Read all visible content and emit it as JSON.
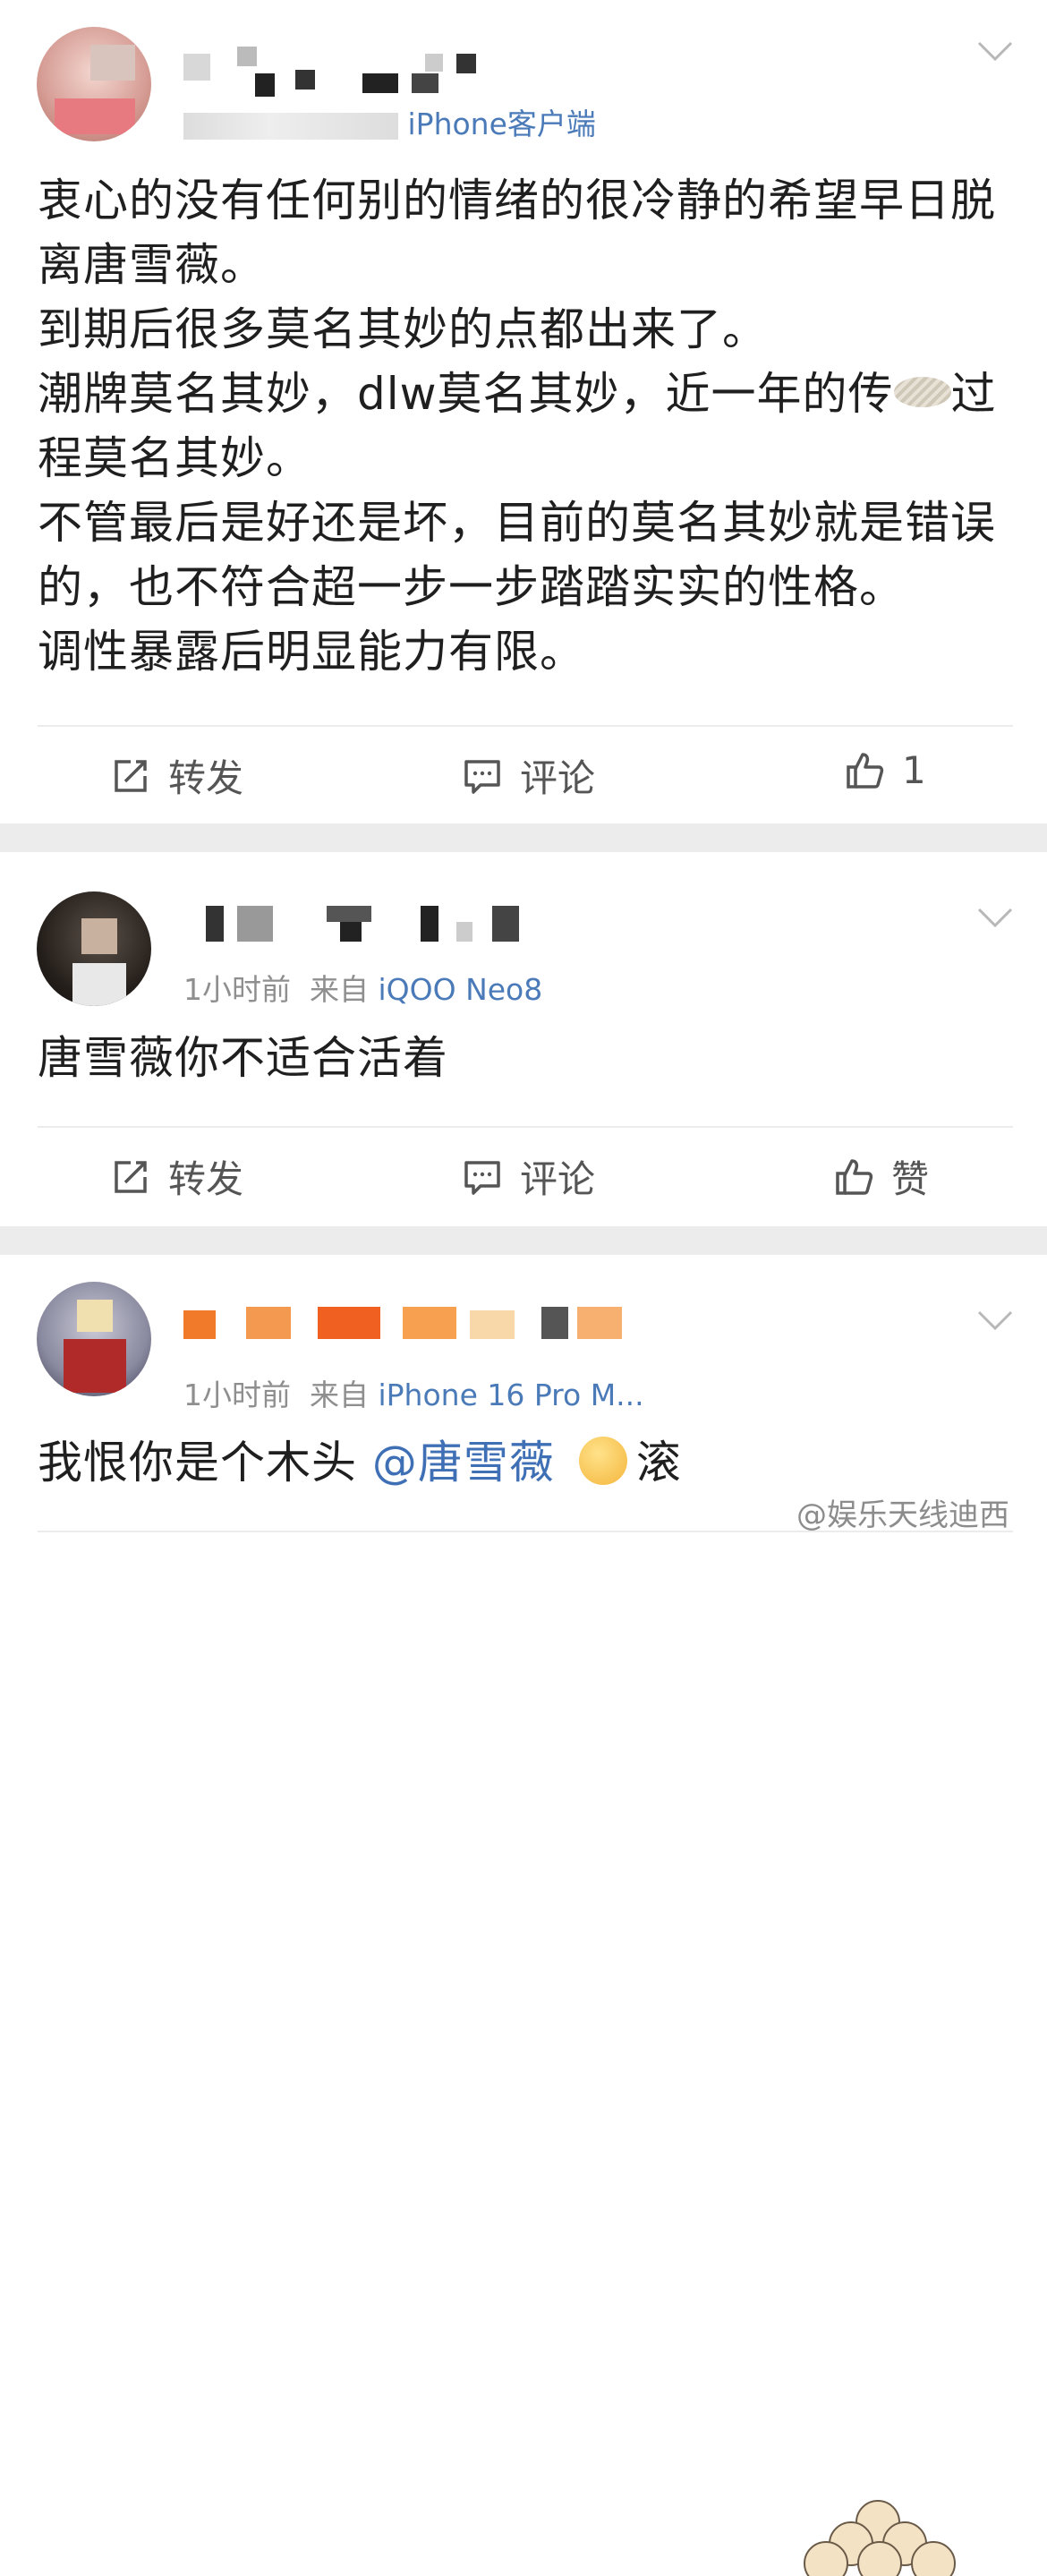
{
  "posts": [
    {
      "username": "",
      "time": "",
      "source_prefix": "",
      "source": "iPhone客户端",
      "body": "衷心的没有任何别的情绪的很冷静的希望早日脱离唐雪薇。\n到期后很多莫名其妙的点都出来了。\n潮牌莫名其妙，dlw莫名其妙，近一年的传",
      "body_tail": "过程莫名其妙。\n不管最后是好还是坏，目前的莫名其妙就是错误的，也不符合超一步一步踏踏实实的性格。\n调性暴露后明显能力有限。",
      "repost_label": "转发",
      "comment_label": "评论",
      "like_label": "1"
    },
    {
      "username": "",
      "time": "1小时前",
      "source_prefix": "来自",
      "source": "iQOO Neo8",
      "body": "唐雪薇你不适合活着",
      "repost_label": "转发",
      "comment_label": "评论",
      "like_label": "赞"
    },
    {
      "username": "",
      "time": "1小时前",
      "source_prefix": "来自",
      "source": "iPhone 16 Pro M...",
      "body_pre": "我恨你是个木头",
      "mention": "@唐雪薇",
      "body_post": "滚"
    }
  ],
  "watermark": "@娱乐天线迪西",
  "icons": {
    "repost": "repost-icon",
    "comment": "comment-icon",
    "like": "thumbs-up-icon",
    "more": "chevron-down-icon"
  },
  "colors": {
    "link": "#4a7ab8",
    "meta": "#8f8f8f",
    "separator": "#ececec"
  }
}
